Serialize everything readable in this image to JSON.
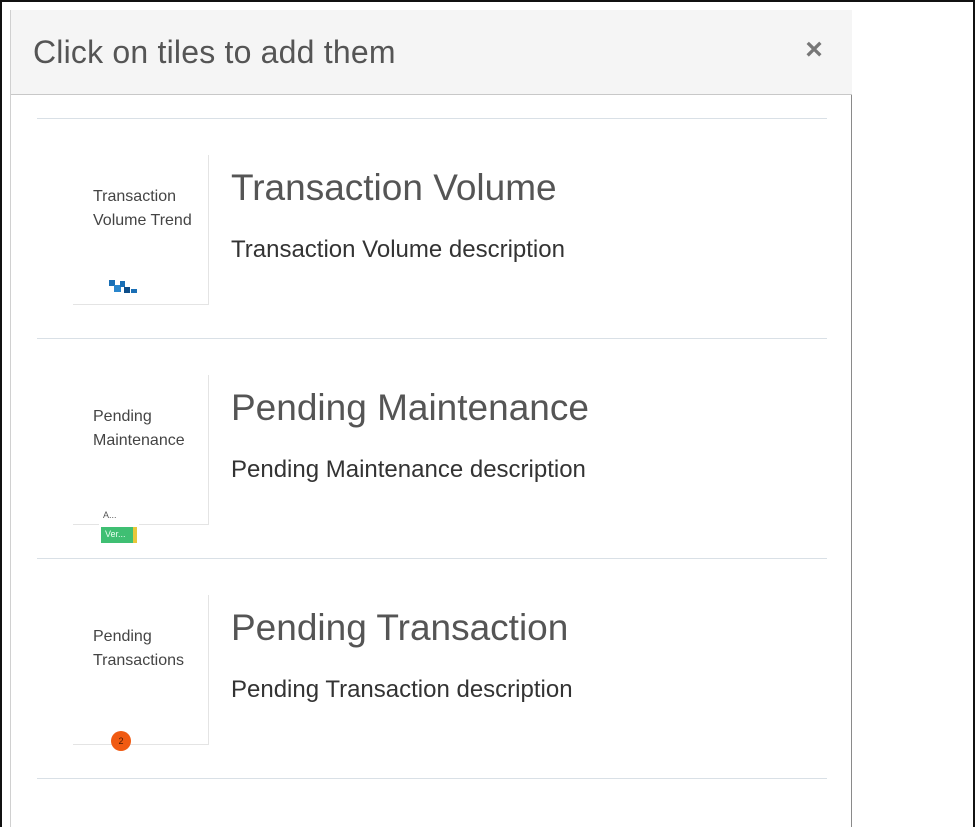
{
  "dialog": {
    "title": "Click on tiles to add them",
    "close_icon": "close-icon",
    "close_label": "×"
  },
  "tiles": [
    {
      "thumb_text": "Transaction Volume Trend",
      "thumb_icon": "bar-chart-icon",
      "title": "Transaction Volume",
      "description": "Transaction Volume description"
    },
    {
      "thumb_text": "Pending Maintenance",
      "thumb_icon": "status-bar-icon",
      "thumb_label_a": "A...",
      "thumb_bar_text": "Ver...",
      "title": "Pending Maintenance",
      "description": "Pending Maintenance description"
    },
    {
      "thumb_text": "Pending Transactions",
      "thumb_icon": "count-badge-icon",
      "badge_count": "2",
      "title": "Pending Transaction",
      "description": "Pending Transaction description"
    }
  ],
  "colors": {
    "header_bg": "#f5f5f5",
    "chart_blue": "#1a6fb5",
    "bar_green": "#3fbf73",
    "bar_yellow": "#e8c73a",
    "badge_orange": "#f05a12"
  }
}
